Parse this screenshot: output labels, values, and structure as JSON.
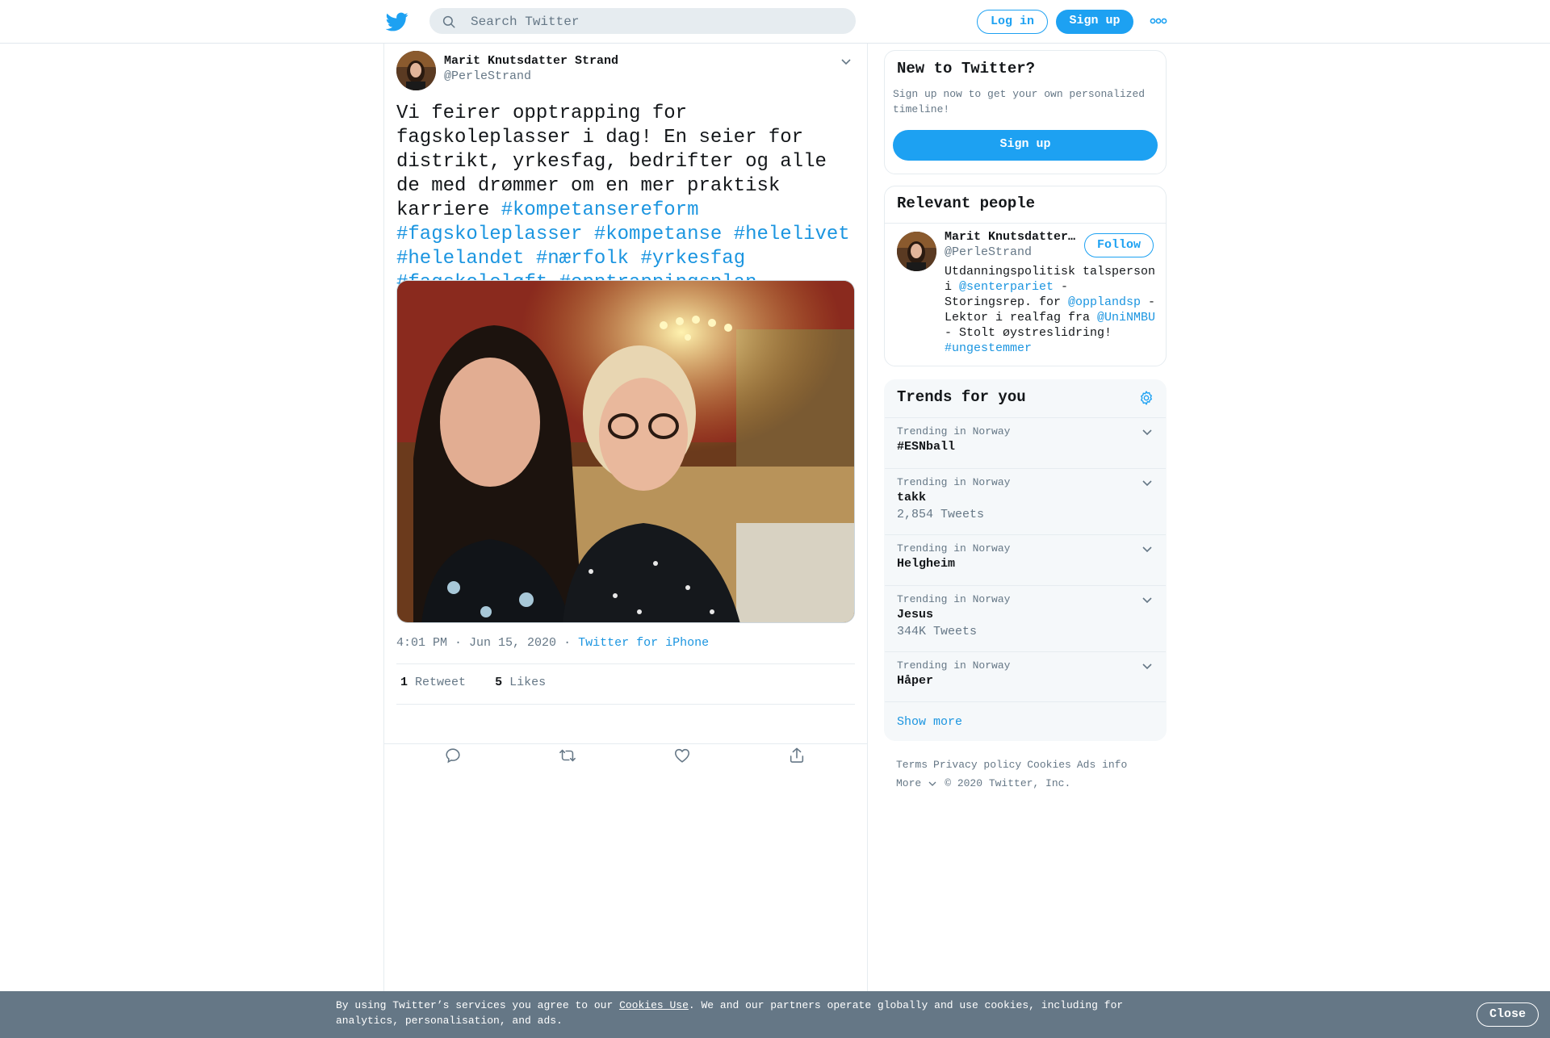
{
  "header": {
    "search_placeholder": "Search Twitter",
    "login_label": "Log in",
    "signup_label": "Sign up",
    "brand_color": "#1da1f2"
  },
  "tweet": {
    "author_name": "Marit Knutsdatter Strand",
    "author_handle": "@PerleStrand",
    "text_plain": "Vi feirer opptrapping for fagskoleplasser i dag! En seier for distrikt, yrkesfag, bedrifter og alle de med drømmer om en mer praktisk karriere ",
    "hashtags": [
      "#kompetansereform",
      "#fagskoleplasser",
      "#kompetanse",
      "#helelivet",
      "#helelandet",
      "#nærfolk",
      "#yrkesfag",
      "#fagskoleløft",
      "#opptrappingsplan"
    ],
    "timestamp": "4:01 PM · Jun 15, 2020",
    "separator": "·",
    "source": "Twitter for iPhone",
    "retweets_count": "1",
    "retweets_label": "Retweet",
    "likes_count": "5",
    "likes_label": "Likes"
  },
  "sidebar": {
    "new_to_twitter": {
      "title": "New to Twitter?",
      "description": "Sign up now to get your own personalized timeline!",
      "button": "Sign up"
    },
    "relevant_people": {
      "title": "Relevant people",
      "name": "Marit Knutsdatter Strand",
      "handle": "@PerleStrand",
      "follow_label": "Follow",
      "bio_1": "Utdanningspolitisk talsperson i ",
      "bio_link_1": "@senterpariet",
      "bio_2": " - Storingsrep. for ",
      "bio_link_2": "@opplandsp",
      "bio_3": " - Lektor i realfag fra ",
      "bio_link_3": "@UniNMBU",
      "bio_4": " - Stolt øystreslidring! ",
      "bio_link_4": "#ungestemmer"
    },
    "trends": {
      "title": "Trends for you",
      "items": [
        {
          "context": "Trending in Norway",
          "name": "#ESNball",
          "count": ""
        },
        {
          "context": "Trending in Norway",
          "name": "takk",
          "count": "2,854 Tweets"
        },
        {
          "context": "Trending in Norway",
          "name": "Helgheim",
          "count": ""
        },
        {
          "context": "Trending in Norway",
          "name": "Jesus",
          "count": "344K Tweets"
        },
        {
          "context": "Trending in Norway",
          "name": "Håper",
          "count": ""
        }
      ],
      "show_more": "Show more"
    },
    "footer": {
      "terms": "Terms",
      "privacy": "Privacy policy",
      "cookies": "Cookies",
      "ads": "Ads info",
      "more": "More",
      "copyright": "© 2020 Twitter, Inc."
    }
  },
  "cookie_bar": {
    "text_before": "By using Twitter’s services you agree to our ",
    "link": "Cookies Use",
    "text_after": ". We and our partners operate globally and use cookies, including for analytics, personalisation, and ads.",
    "close_label": "Close"
  }
}
